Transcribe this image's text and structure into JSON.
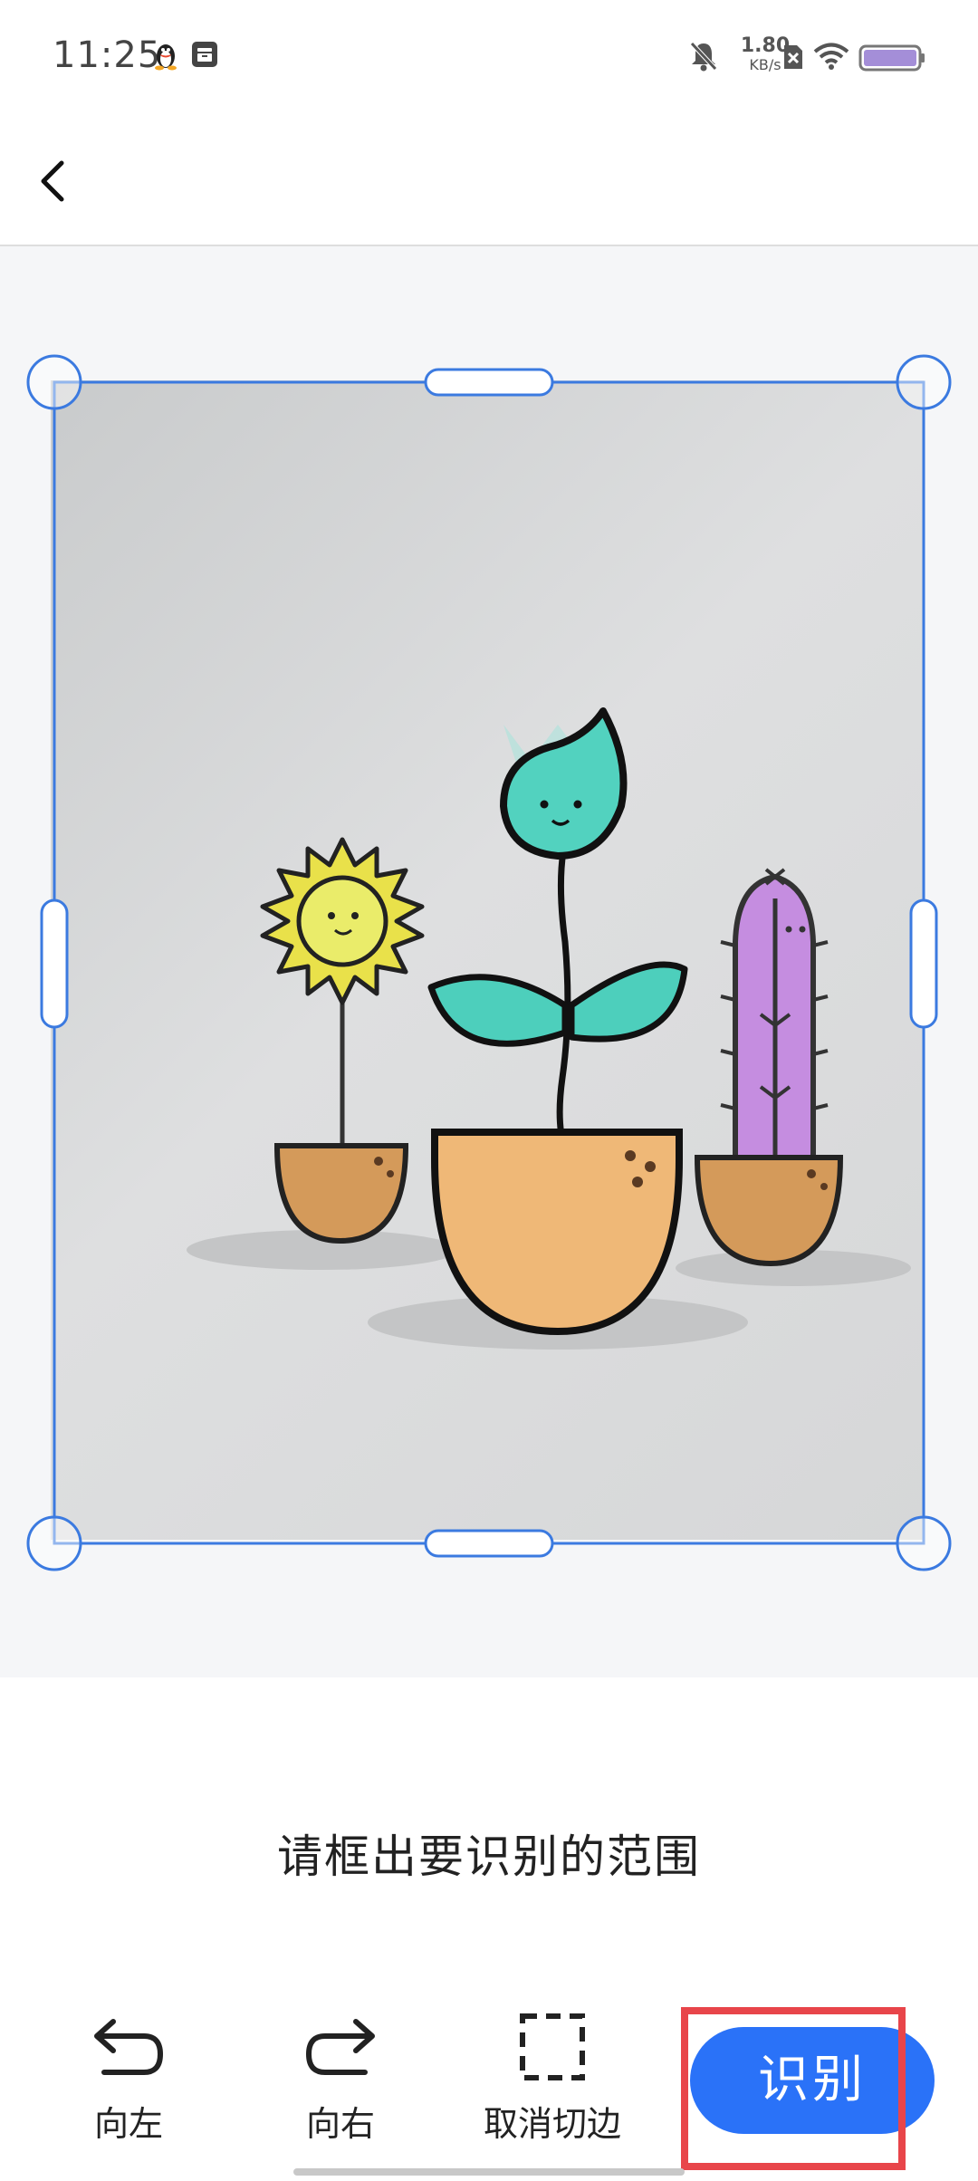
{
  "status_bar": {
    "time": "11:25",
    "net_speed_value": "1.80",
    "net_speed_unit": "KB/s",
    "left_icons": [
      "qq-penguin-icon",
      "app-store-icon"
    ],
    "right_icons": [
      "mute-bell-icon",
      "sim-off-icon",
      "wifi-icon",
      "battery-icon"
    ]
  },
  "header": {
    "back_icon": "chevron-left-icon"
  },
  "crop": {
    "instruction": "请框出要识别的范围",
    "accent_color": "#3b7ae0"
  },
  "toolbar": {
    "rotate_left_label": "向左",
    "rotate_right_label": "向右",
    "cancel_crop_label": "取消切边",
    "recognize_label": "识别"
  },
  "colors": {
    "primary": "#2a72f8",
    "highlight": "#e8454a"
  }
}
